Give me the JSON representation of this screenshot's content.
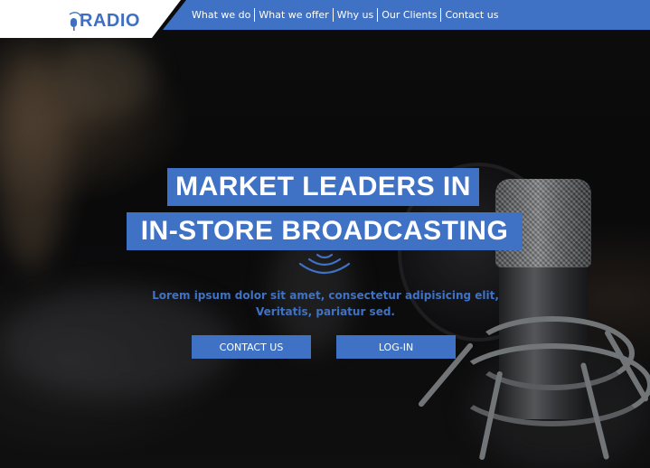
{
  "brand": {
    "logo_text": "RADIO"
  },
  "nav": {
    "items": [
      {
        "label": "What we do"
      },
      {
        "label": "What we offer"
      },
      {
        "label": "Why us"
      },
      {
        "label": "Our Clients"
      },
      {
        "label": "Contact us"
      }
    ]
  },
  "hero": {
    "headline_line1": "MARKET LEADERS IN",
    "headline_line2": "IN-STORE BROADCASTING",
    "subtitle": "Lorem ipsum dolor sit amet, consectetur adipisicing elit, Veritatis, pariatur sed.",
    "cta_primary": "CONTACT US",
    "cta_secondary": "LOG-IN"
  },
  "icons": {
    "logo_mark": "microphone-icon",
    "hero_decoration": "broadcast-waves-icon"
  },
  "colors": {
    "accent": "#3f72c4",
    "header_bg": "#ffffff",
    "text_light": "#ffffff"
  }
}
